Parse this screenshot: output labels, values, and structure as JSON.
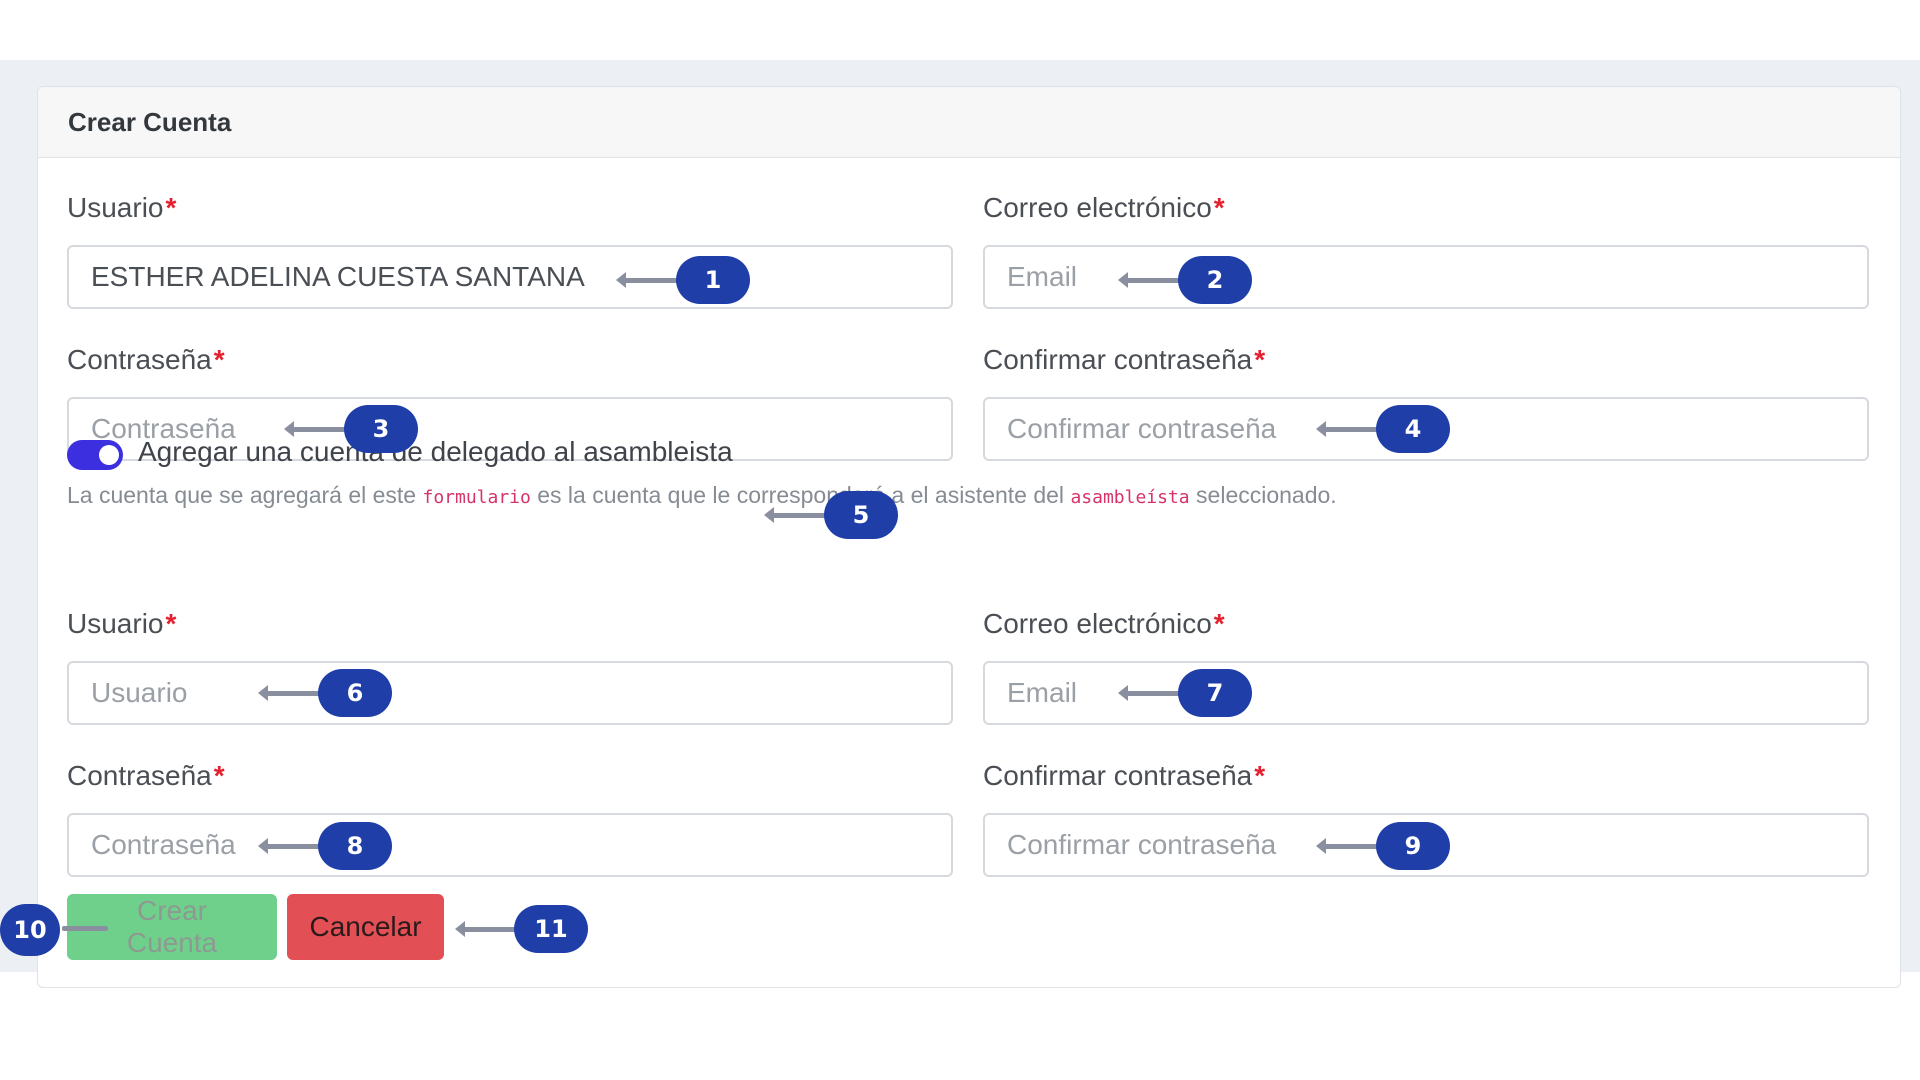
{
  "card": {
    "title": "Crear Cuenta"
  },
  "required_mark": "*",
  "form1": {
    "usuario_label": "Usuario",
    "usuario_value": "ESTHER ADELINA CUESTA SANTANA",
    "email_label": "Correo electrónico",
    "email_placeholder": "Email",
    "password_label": "Contraseña",
    "password_placeholder": "Contraseña",
    "confirm_label": "Confirmar contraseña",
    "confirm_placeholder": "Confirmar contraseña"
  },
  "delegate": {
    "toggle_on": true,
    "toggle_label": "Agregar una cuenta de delegado al asambleista",
    "help_part1": "La cuenta que se agregará el este ",
    "help_code1": "formulario",
    "help_part2": " es la cuenta que le corresponderá a el asistente del ",
    "help_code2": "asambleísta",
    "help_part3": " seleccionado."
  },
  "form2": {
    "usuario_label": "Usuario",
    "usuario_placeholder": "Usuario",
    "email_label": "Correo electrónico",
    "email_placeholder": "Email",
    "password_label": "Contraseña",
    "password_placeholder": "Contraseña",
    "confirm_label": "Confirmar contraseña",
    "confirm_placeholder": "Confirmar contraseña"
  },
  "buttons": {
    "create": "Crear Cuenta",
    "cancel": "Cancelar"
  },
  "annotations": [
    "1",
    "2",
    "3",
    "4",
    "5",
    "6",
    "7",
    "8",
    "9",
    "10",
    "11"
  ],
  "colors": {
    "toggle_active": "#3b2fe0",
    "create_button": "#6fd08c",
    "cancel_button": "#e24f54",
    "required": "#e5202f",
    "badge": "#1f3ea8",
    "code_text": "#d6336c"
  }
}
